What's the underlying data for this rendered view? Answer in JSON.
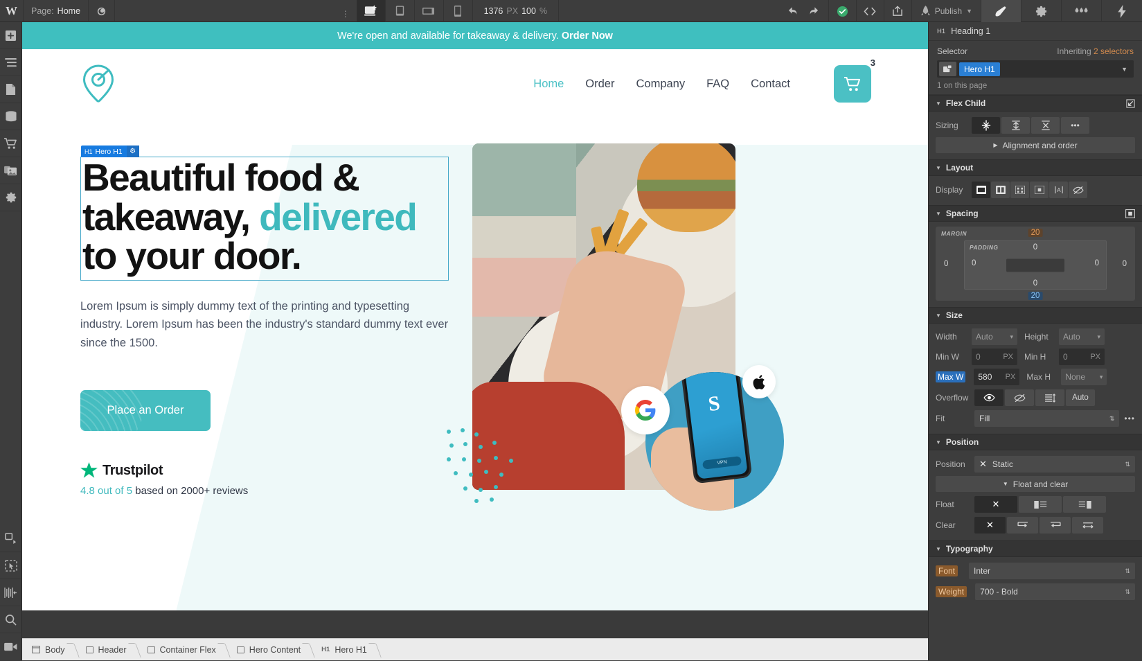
{
  "topbar": {
    "logo": "W",
    "page_label": "Page:",
    "page_name": "Home",
    "viewports": [
      {
        "name": "desktop",
        "active": true
      },
      {
        "name": "tablet",
        "active": false
      },
      {
        "name": "mobile-landscape",
        "active": false
      },
      {
        "name": "mobile-portrait",
        "active": false
      }
    ],
    "canvas_width": "1376",
    "canvas_width_unit": "PX",
    "zoom": "100",
    "zoom_unit": "%",
    "publish_label": "Publish",
    "panel_tabs": [
      {
        "name": "style",
        "active": true
      },
      {
        "name": "settings",
        "active": false
      },
      {
        "name": "interactions",
        "active": false
      },
      {
        "name": "effects",
        "active": false
      }
    ]
  },
  "left_rail": [
    {
      "name": "add-elements"
    },
    {
      "name": "navigator"
    },
    {
      "name": "pages"
    },
    {
      "name": "cms-collections"
    },
    {
      "name": "ecommerce"
    },
    {
      "name": "assets"
    },
    {
      "name": "settings"
    },
    {
      "name": "components"
    },
    {
      "name": "symbols"
    },
    {
      "name": "audit"
    },
    {
      "name": "search"
    },
    {
      "name": "video-tutorials"
    }
  ],
  "canvas": {
    "announcement": {
      "text": "We're open and available for takeaway & delivery.",
      "cta": "Order Now"
    },
    "nav": {
      "links": [
        {
          "label": "Home",
          "active": true
        },
        {
          "label": "Order",
          "active": false
        },
        {
          "label": "Company",
          "active": false
        },
        {
          "label": "FAQ",
          "active": false
        },
        {
          "label": "Contact",
          "active": false
        }
      ],
      "cart_count": "3"
    },
    "hero": {
      "badge_tag": "H1",
      "badge_label": "Hero H1",
      "heading_line1": "Beautiful food &",
      "heading_line2a": "takeaway, ",
      "heading_accent": "delivered",
      "heading_line3": "to your door.",
      "paragraph": "Lorem Ipsum is simply dummy text of the printing and typesetting industry. Lorem Ipsum has been the industry's standard dummy text ever since the 1500.",
      "cta_button": "Place an Order",
      "trustpilot_name": "Trustpilot",
      "rating_score": "4.8 out of 5",
      "rating_rest": " based on 2000+ reviews"
    }
  },
  "right_panel": {
    "element_tag": "H1",
    "element_name": "Heading 1",
    "selector_label": "Selector",
    "inheriting_prefix": "Inheriting ",
    "inheriting_count": "2 selectors",
    "selector_chip": "Hero H1",
    "selector_note": "1 on this page",
    "flex_child": {
      "title": "Flex Child",
      "sizing_label": "Sizing",
      "alignment_label": "Alignment and order"
    },
    "layout": {
      "title": "Layout",
      "display_label": "Display"
    },
    "spacing": {
      "title": "Spacing",
      "margin_label": "MARGIN",
      "padding_label": "PADDING",
      "margin_top": "20",
      "margin_bottom": "20",
      "margin_left": "0",
      "margin_right": "0",
      "padding_top": "0",
      "padding_bottom": "0",
      "padding_left": "0",
      "padding_right": "0"
    },
    "size": {
      "title": "Size",
      "width_label": "Width",
      "width_value": "Auto",
      "height_label": "Height",
      "height_value": "Auto",
      "minw_label": "Min W",
      "minw_value": "0",
      "minw_unit": "PX",
      "minh_label": "Min H",
      "minh_value": "0",
      "minh_unit": "PX",
      "maxw_label": "Max W",
      "maxw_value": "580",
      "maxw_unit": "PX",
      "maxh_label": "Max H",
      "maxh_value": "None",
      "overflow_label": "Overflow",
      "overflow_auto": "Auto",
      "fit_label": "Fit",
      "fit_value": "Fill"
    },
    "position": {
      "title": "Position",
      "position_label": "Position",
      "position_value": "Static",
      "float_clear_label": "Float and clear",
      "float_label": "Float",
      "clear_label": "Clear"
    },
    "typography": {
      "title": "Typography",
      "font_label": "Font",
      "font_value": "Inter",
      "weight_label": "Weight",
      "weight_value": "700 - Bold"
    }
  },
  "breadcrumb": [
    {
      "tag": "body",
      "label": "Body"
    },
    {
      "tag": "box",
      "label": "Header"
    },
    {
      "tag": "box",
      "label": "Container Flex"
    },
    {
      "tag": "box",
      "label": "Hero Content"
    },
    {
      "tag": "h1",
      "label": "Hero H1"
    }
  ],
  "colors": {
    "brand_teal": "#45bdc0",
    "selection_blue": "#177be0",
    "accent_orange": "#d18a4e",
    "publish_green": "#3aaa6d"
  }
}
